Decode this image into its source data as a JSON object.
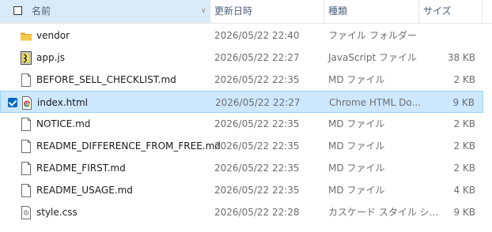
{
  "columns": {
    "name": "名前",
    "date": "更新日時",
    "type": "種類",
    "size": "サイズ"
  },
  "files": [
    {
      "name": "vendor",
      "date": "2026/05/22 22:40",
      "type": "ファイル フォルダー",
      "size": "",
      "icon": "folder-icon",
      "selected": false
    },
    {
      "name": "app.js",
      "date": "2026/05/22 22:27",
      "type": "JavaScript ファイル",
      "size": "38 KB",
      "icon": "javascript-file-icon",
      "selected": false
    },
    {
      "name": "BEFORE_SELL_CHECKLIST.md",
      "date": "2026/05/22 22:35",
      "type": "MD ファイル",
      "size": "2 KB",
      "icon": "document-file-icon",
      "selected": false
    },
    {
      "name": "index.html",
      "date": "2026/05/22 22:27",
      "type": "Chrome HTML Do...",
      "size": "9 KB",
      "icon": "chrome-html-file-icon",
      "selected": true
    },
    {
      "name": "NOTICE.md",
      "date": "2026/05/22 22:35",
      "type": "MD ファイル",
      "size": "2 KB",
      "icon": "document-file-icon",
      "selected": false
    },
    {
      "name": "README_DIFFERENCE_FROM_FREE.md",
      "date": "2026/05/22 22:35",
      "type": "MD ファイル",
      "size": "2 KB",
      "icon": "document-file-icon",
      "selected": false
    },
    {
      "name": "README_FIRST.md",
      "date": "2026/05/22 22:35",
      "type": "MD ファイル",
      "size": "2 KB",
      "icon": "document-file-icon",
      "selected": false
    },
    {
      "name": "README_USAGE.md",
      "date": "2026/05/22 22:35",
      "type": "MD ファイル",
      "size": "4 KB",
      "icon": "document-file-icon",
      "selected": false
    },
    {
      "name": "style.css",
      "date": "2026/05/22 22:28",
      "type": "カスケード スタイル シ...",
      "size": "9 KB",
      "icon": "css-file-icon",
      "selected": false
    }
  ],
  "colors": {
    "accent": "#0067c0",
    "selection": "#cce8ff",
    "selection_border": "#99d1ff",
    "header_sorted": "#d9ebf9",
    "folder": "#f8c84b"
  }
}
